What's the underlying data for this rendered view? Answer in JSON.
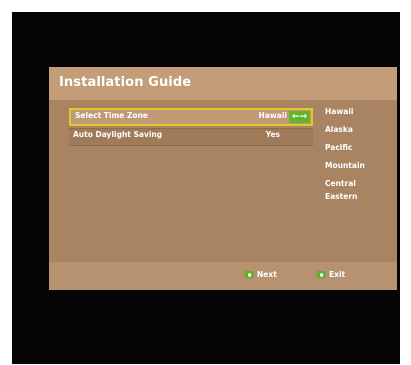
{
  "screen": {
    "title": "Installation Guide",
    "rows": [
      {
        "label": "Select Time Zone",
        "value": "Hawaii",
        "selected": true
      },
      {
        "label": "Auto Daylight Saving",
        "value": "Yes",
        "selected": false
      }
    ],
    "arrows_glyph": "←→",
    "options": [
      "Hawaii",
      "Alaska",
      "Pacific",
      "Mountain",
      "Central",
      "Eastern"
    ],
    "footer": {
      "next_label": "Next",
      "exit_label": "Exit"
    }
  },
  "colors": {
    "panel": "#b08d6c",
    "title_bar": "#c29d77",
    "selection_border": "#e0c826",
    "green_key": "#5fae2a",
    "background": "#060404"
  }
}
